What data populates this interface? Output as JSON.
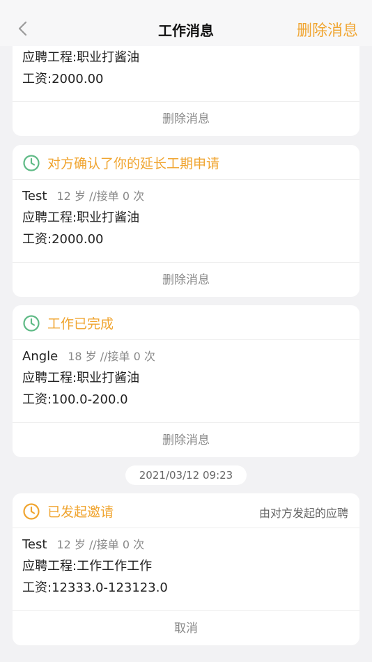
{
  "nav": {
    "title": "工作消息",
    "action_label": "删除消息"
  },
  "cards": [
    {
      "status": "",
      "note": "",
      "name": "",
      "meta": "",
      "project": "应聘工程:职业打酱油",
      "salary": "工资:2000.00",
      "footer_action": "删除消息"
    },
    {
      "status": "对方确认了你的延长工期申请",
      "status_color": "#f0a531",
      "icon_color": "#5fba86",
      "name": "Test",
      "meta": "12 岁 //接单 0 次",
      "project": "应聘工程:职业打酱油",
      "salary": "工资:2000.00",
      "footer_action": "删除消息"
    },
    {
      "status": "工作已完成",
      "status_color": "#f0a531",
      "icon_color": "#5fba86",
      "name": "Angle",
      "meta": "18 岁 //接单 0 次",
      "project": "应聘工程:职业打酱油",
      "salary": "工资:100.0-200.0",
      "footer_action": "删除消息"
    },
    {
      "status": "已发起邀请",
      "status_color": "#f0a531",
      "icon_color": "#f0a531",
      "note": "由对方发起的应聘",
      "name": "Test",
      "meta": "12 岁 //接单 0 次",
      "project": "应聘工程:工作工作工作",
      "salary": "工资:12333.0-123123.0",
      "footer_action": "取消"
    }
  ],
  "timestamp": "2021/03/12 09:23",
  "icons": {
    "back": "chevron-left-icon",
    "clock": "clock-icon"
  }
}
